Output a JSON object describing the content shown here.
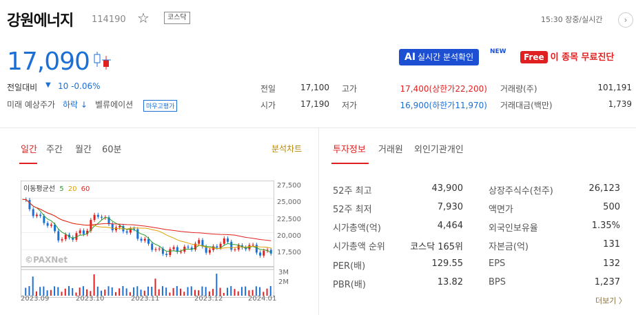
{
  "header": {
    "name": "강원에너지",
    "code": "114190",
    "market": "코스닥",
    "realtime": "15:30 장중/실시간"
  },
  "price": {
    "current": "17,090",
    "change_label": "전일대비",
    "change": "10 -0.06%",
    "prediction_label": "미래 예상주가",
    "prediction": "하락 ↓",
    "valuation_label": "벨류에이션",
    "valuation_badge": "마우고평가"
  },
  "buttons": {
    "ai_prefix": "AI",
    "ai_label": "실시간 분석확인",
    "new_badge": "NEW",
    "free_prefix": "Free",
    "free_label": "이 종목 무료진단"
  },
  "stats": [
    {
      "label": "전일",
      "value": "17,100"
    },
    {
      "label": "시가",
      "value": "17,190"
    },
    {
      "label": "고가",
      "value": "17,400(상한가22,200)"
    },
    {
      "label": "저가",
      "value": "16,900(하한가11,970)"
    },
    {
      "label": "거래량(주)",
      "value": "101,191"
    },
    {
      "label": "거래대금(백만)",
      "value": "1,739"
    }
  ],
  "chart_tabs": [
    "일간",
    "주간",
    "월간",
    "60분"
  ],
  "chart_link": "분석차트",
  "info_tabs": [
    "투자정보",
    "거래원",
    "외인기관개인"
  ],
  "chart": {
    "ma_label": "이동평균선",
    "ma5": "5",
    "ma20": "20",
    "ma60": "60",
    "watermark": "©PAXNet",
    "y_ticks": [
      "27,500",
      "25,000",
      "22,500",
      "20,000",
      "17,500"
    ],
    "vol_ticks": [
      "3M",
      "2M"
    ],
    "x_ticks": [
      "2023.09",
      "2023.10",
      "2023.11",
      "2023.12",
      "2024.01"
    ]
  },
  "chart_data": {
    "type": "candlestick",
    "ylim": [
      15000,
      27500
    ],
    "x": [
      "2023.09",
      "2023.10",
      "2023.11",
      "2023.12",
      "2024.01"
    ],
    "close": [
      24500,
      23000,
      21000,
      19500,
      19000,
      20500,
      22500,
      21500,
      20000,
      20500,
      18000,
      17500,
      17000,
      17800,
      18200,
      17500,
      18500,
      18000,
      17800,
      17400,
      17100
    ]
  },
  "info_left": [
    {
      "label": "52주 최고",
      "value": "43,900"
    },
    {
      "label": "52주 최저",
      "value": "7,930"
    },
    {
      "label": "시가총액(억)",
      "value": "4,464"
    },
    {
      "label": "시가총액 순위",
      "value": "코스닥 165위"
    },
    {
      "label": "PER(배)",
      "value": "129.55"
    },
    {
      "label": "PBR(배)",
      "value": "13.82"
    }
  ],
  "info_right": [
    {
      "label": "상장주식수(천주)",
      "value": "26,123"
    },
    {
      "label": "액면가",
      "value": "500"
    },
    {
      "label": "외국인보유율",
      "value": "1.35%"
    },
    {
      "label": "자본금(억)",
      "value": "131"
    },
    {
      "label": "EPS",
      "value": "132"
    },
    {
      "label": "BPS",
      "value": "1,237"
    }
  ],
  "more": "더보기 〉",
  "colors": {
    "up": "#e02020",
    "down": "#1b6fd5",
    "ma5": "#2a9d2a",
    "ma20": "#e0a000",
    "ma60": "#e02020"
  }
}
